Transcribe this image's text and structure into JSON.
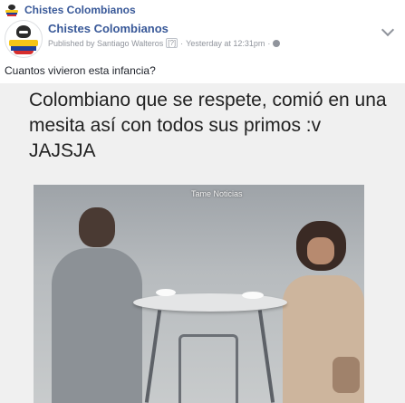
{
  "top_bar": {
    "page_link": "Chistes Colombianos"
  },
  "post": {
    "page_name": "Chistes Colombianos",
    "published_by": "Published by Santiago Walteros",
    "question_mark": "[?]",
    "separator": "·",
    "time": "Yesterday at 12:31pm",
    "separator2": "·",
    "text": "Cuantos vivieron esta infancia?"
  },
  "image": {
    "caption": "Colombiano que se respete, comió en una mesita así con todos sus primos :v JAJSJA",
    "watermark": "Tame Noticias"
  },
  "icons": {
    "privacy": "globe-icon",
    "menu": "chevron-down-icon"
  },
  "colors": {
    "link": "#385898",
    "meta": "#90949c",
    "text": "#1d2129"
  }
}
